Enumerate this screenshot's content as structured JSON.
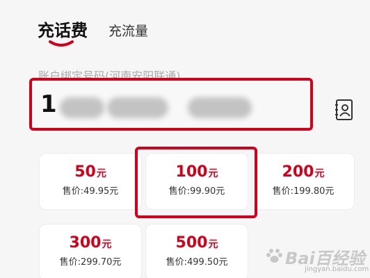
{
  "tabs": {
    "recharge_label": "充话费",
    "data_label": "充流量"
  },
  "phone": {
    "label": "账户绑定号码(河南安阳联通)",
    "value_prefix": "1"
  },
  "products": [
    {
      "amount": "50",
      "unit": "元",
      "price": "售价:49.95元"
    },
    {
      "amount": "100",
      "unit": "元",
      "price": "售价:99.90元"
    },
    {
      "amount": "200",
      "unit": "元",
      "price": "售价:199.80元"
    },
    {
      "amount": "300",
      "unit": "元",
      "price": "售价:299.70元"
    },
    {
      "amount": "500",
      "unit": "元",
      "price": "售价:499.50元"
    }
  ],
  "watermark": {
    "text": "Bai百经验",
    "url": "jingyan.baidu.com"
  },
  "colors": {
    "accent": "#d4001a",
    "highlight_border": "#d4001a"
  },
  "icons": {
    "contact": "contact-book-icon"
  }
}
